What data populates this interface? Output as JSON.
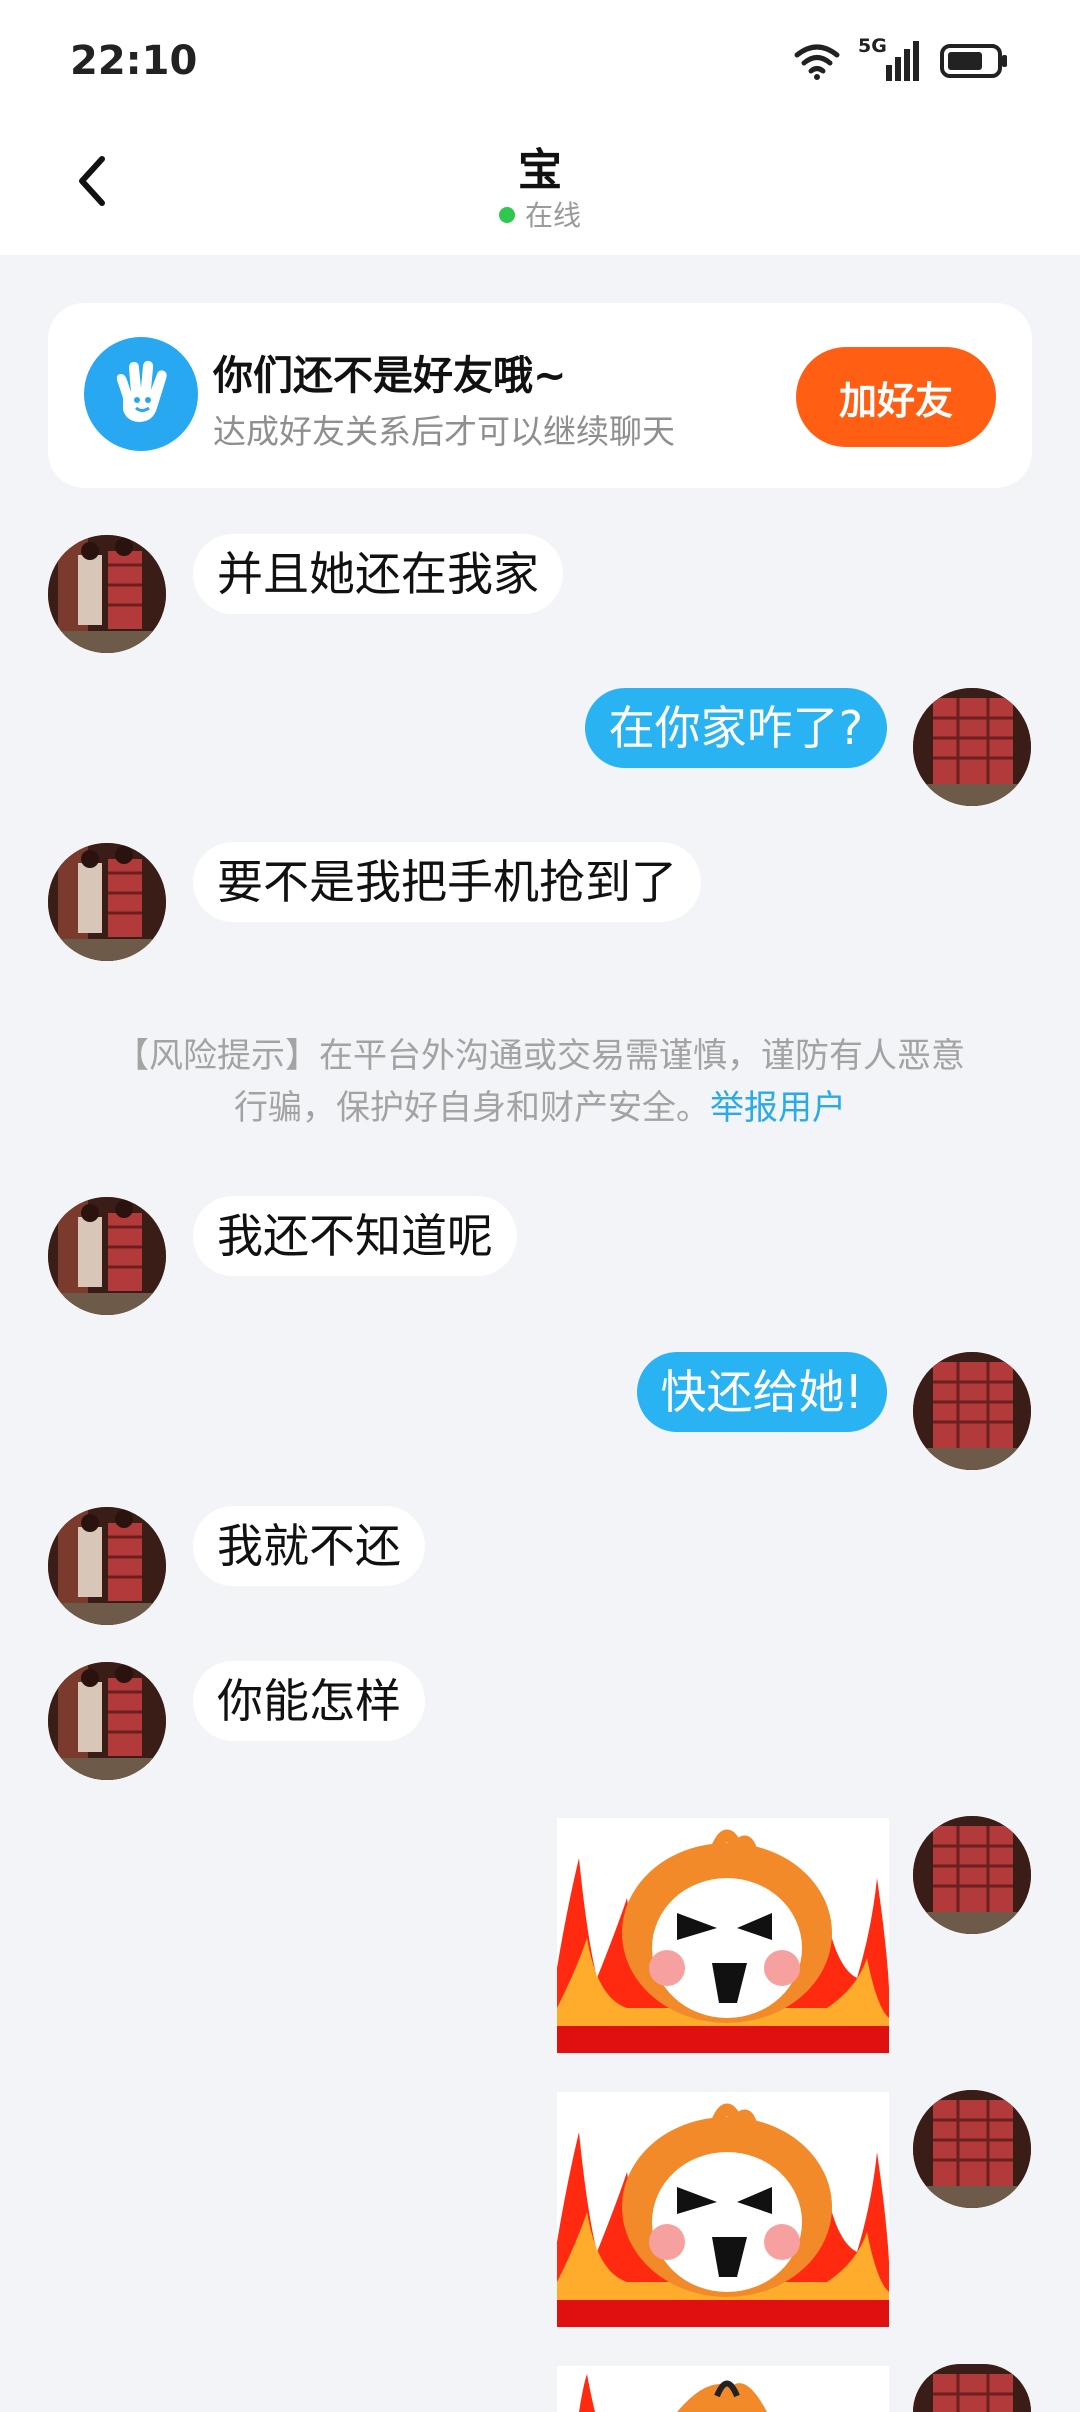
{
  "status_bar": {
    "time": "22:10",
    "network": "5G",
    "icons": [
      "wifi-icon",
      "signal-icon",
      "battery-icon"
    ]
  },
  "header": {
    "title": "宝",
    "status": "在线",
    "back_icon": "chevron-left-icon"
  },
  "friend_card": {
    "icon": "hand-wave-icon",
    "title": "你们还不是好友哦~",
    "subtitle": "达成好友关系后才可以继续聊天",
    "button": "加好友"
  },
  "messages": [
    {
      "side": "left",
      "text": "并且她还在我家"
    },
    {
      "side": "right",
      "text": "在你家咋了?"
    },
    {
      "side": "left",
      "text": "要不是我把手机抢到了"
    },
    {
      "side": "left",
      "text": "我还不知道呢"
    },
    {
      "side": "right",
      "text": "快还给她!"
    },
    {
      "side": "left",
      "text": "我就不还"
    },
    {
      "side": "left",
      "text": "你能怎样"
    },
    {
      "side": "right",
      "type": "sticker"
    },
    {
      "side": "right",
      "type": "sticker"
    },
    {
      "side": "right",
      "type": "sticker"
    }
  ],
  "risk_notice": {
    "text_line1": "【风险提示】在平台外沟通或交易需谨慎，谨防有人恶意",
    "text_line2": "行骗，保护好自身和财产安全。",
    "link": "举报用户"
  },
  "colors": {
    "accent_blue": "#2ab3f2",
    "add_button": "#ff5e13",
    "online_dot": "#2dc84d",
    "background": "#f2f4f7"
  }
}
